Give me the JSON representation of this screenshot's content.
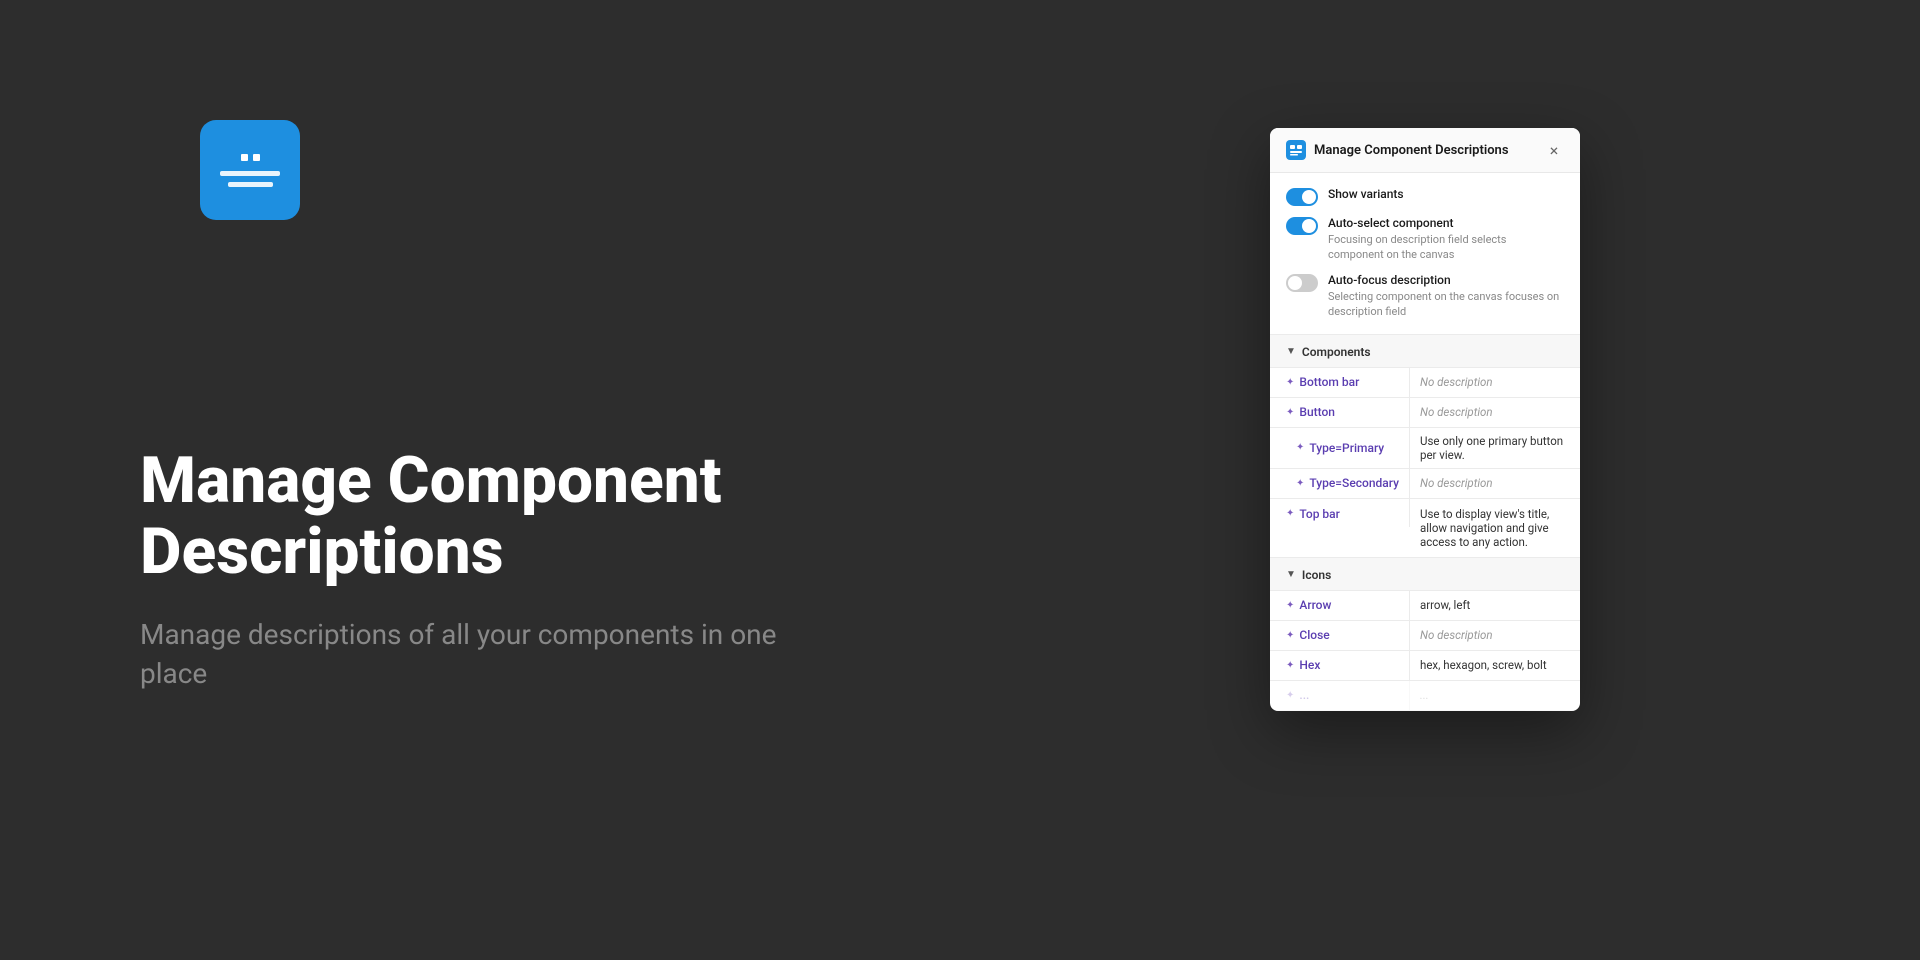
{
  "background_color": "#2d2d2d",
  "left": {
    "app_icon_alt": "Manage Component Descriptions App Icon",
    "main_title": "Manage Component Descriptions",
    "subtitle": "Manage descriptions of all your components in one place"
  },
  "panel": {
    "title": "Manage Component Descriptions",
    "close_button_label": "×",
    "settings": [
      {
        "id": "show-variants",
        "label": "Show variants",
        "description": "",
        "enabled": true
      },
      {
        "id": "auto-select-component",
        "label": "Auto-select component",
        "description": "Focusing on description field selects component on the canvas",
        "enabled": true
      },
      {
        "id": "auto-focus-description",
        "label": "Auto-focus description",
        "description": "Selecting component on the canvas focuses on description field",
        "enabled": false
      }
    ],
    "sections": [
      {
        "title": "Components",
        "items": [
          {
            "name": "Bottom bar",
            "description": "",
            "placeholder": "No description",
            "indented": false
          },
          {
            "name": "Button",
            "description": "",
            "placeholder": "No description",
            "indented": false
          },
          {
            "name": "Type=Primary",
            "description": "Use only one primary button per view.",
            "placeholder": "",
            "indented": true
          },
          {
            "name": "Type=Secondary",
            "description": "",
            "placeholder": "No description",
            "indented": true
          },
          {
            "name": "Top bar",
            "description": "Use to display view's title, allow navigation and give access to any action.",
            "placeholder": "",
            "indented": false
          }
        ]
      },
      {
        "title": "Icons",
        "items": [
          {
            "name": "Arrow",
            "description": "arrow, left",
            "placeholder": "",
            "indented": false
          },
          {
            "name": "Close",
            "description": "",
            "placeholder": "No description",
            "indented": false
          },
          {
            "name": "Hex",
            "description": "hex, hexagon, screw, bolt",
            "placeholder": "",
            "indented": false
          },
          {
            "name": "...",
            "description": "...",
            "placeholder": "",
            "indented": false
          }
        ]
      }
    ]
  }
}
